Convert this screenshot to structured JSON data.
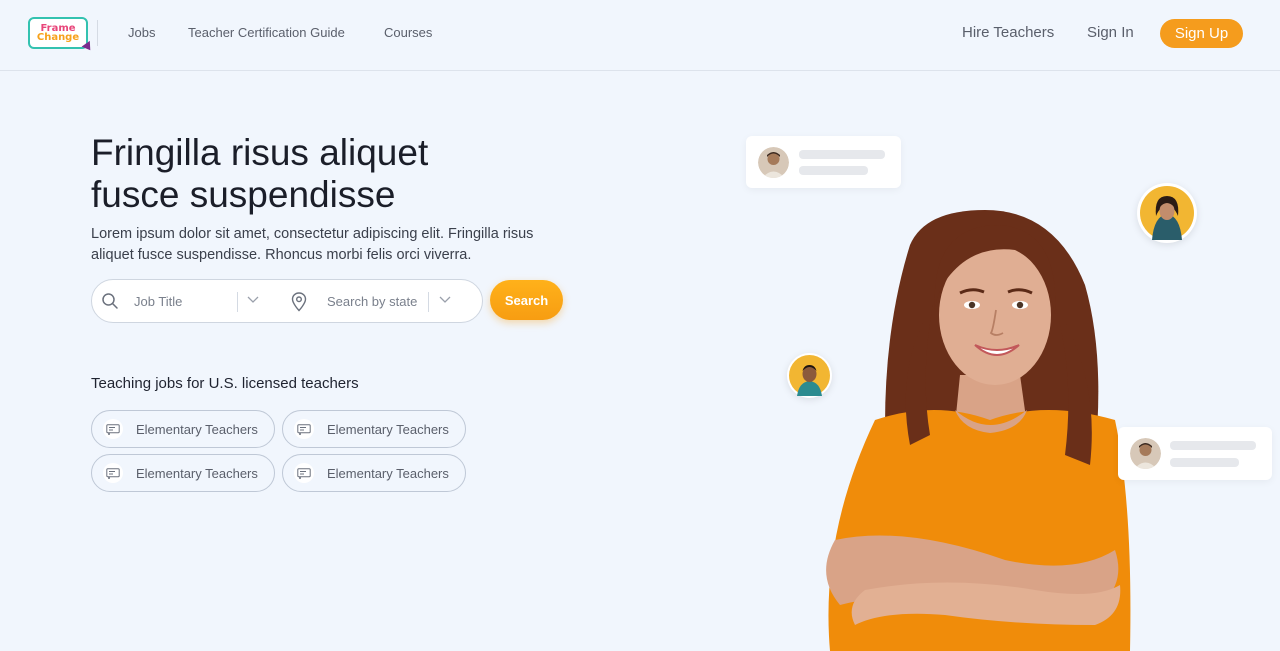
{
  "header": {
    "logo": {
      "line1": "Frame",
      "line2": "Change"
    },
    "nav": [
      {
        "label": "Jobs"
      },
      {
        "label": "Teacher Certification Guide"
      },
      {
        "label": "Courses"
      }
    ],
    "hire_label": "Hire Teachers",
    "signin_label": "Sign In",
    "signup_label": "Sign Up"
  },
  "hero": {
    "title_line1": "Fringilla risus aliquet",
    "title_line2": "fusce suspendisse",
    "subtitle": "Lorem ipsum dolor sit amet, consectetur adipiscing elit. Fringilla risus aliquet fusce suspendisse. Rhoncus morbi felis orci viverra."
  },
  "search": {
    "job_placeholder": "Job Title",
    "state_placeholder": "Search by state",
    "button_label": "Search"
  },
  "jobs": {
    "heading": "Teaching jobs for U.S. licensed teachers",
    "chips": [
      {
        "label": "Elementary Teachers"
      },
      {
        "label": "Elementary Teachers"
      },
      {
        "label": "Elementary Teachers"
      },
      {
        "label": "Elementary Teachers"
      }
    ]
  },
  "colors": {
    "accent": "#f59c1d",
    "background": "#f1f6fd",
    "shirt": "#f08c0a"
  },
  "icons": [
    "search-icon",
    "chevron-down-icon",
    "location-pin-icon",
    "certificate-icon"
  ]
}
